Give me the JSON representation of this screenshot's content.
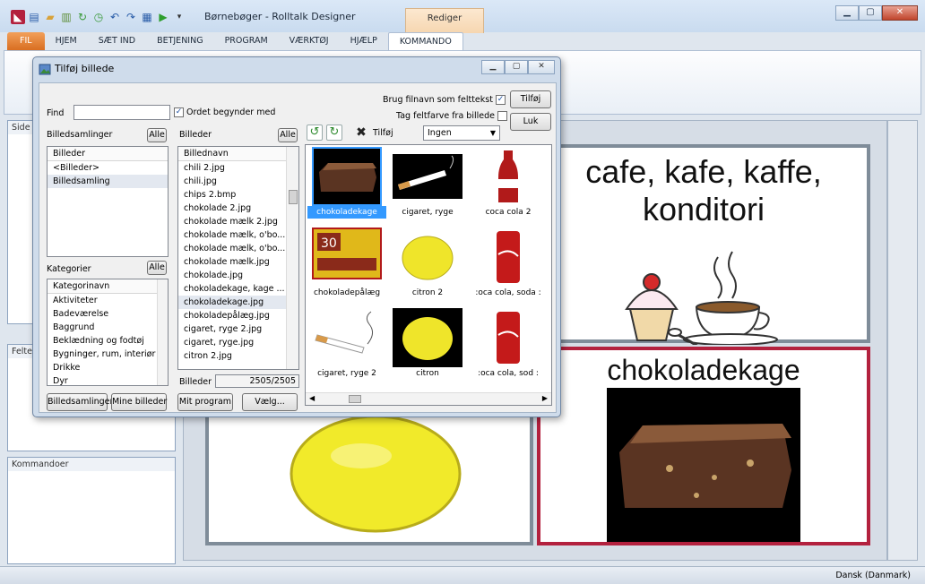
{
  "app": {
    "title": "Børnebøger - Rolltalk Designer",
    "context_tab": "Rediger"
  },
  "ribbon_tabs": [
    {
      "label": "FIL"
    },
    {
      "label": "HJEM"
    },
    {
      "label": "SÆT IND"
    },
    {
      "label": "BETJENING"
    },
    {
      "label": "PROGRAM"
    },
    {
      "label": "VÆRKTØJ"
    },
    {
      "label": "HJÆLP"
    },
    {
      "label": "KOMMANDO"
    }
  ],
  "left_panel": {
    "sider_label": "Side",
    "felter_label": "Felte",
    "kommandoer_label": "Kommandoer"
  },
  "cells": {
    "top_right_text_1": "cafe, kafe, kaffe,",
    "top_right_text_2": "konditori",
    "bottom_right_text": "chokoladekage"
  },
  "status": {
    "language": "Dansk (Danmark)"
  },
  "dialog": {
    "title": "Tilføj billede",
    "find_label": "Find",
    "find_value": "",
    "starts_with_label": "Ordet begynder med",
    "starts_with_checked": true,
    "use_filename_label": "Brug filnavn som felttekst",
    "use_filename_checked": true,
    "take_color_label": "Tag feltfarve fra billede",
    "take_color_checked": false,
    "add_button": "Tilføj",
    "close_button": "Luk",
    "collections_label": "Billedsamlinger",
    "collections_all": "Alle",
    "collections_header": "Billeder",
    "collections": [
      "<Billeder>",
      "Billedsamling"
    ],
    "categories_label": "Kategorier",
    "categories_all": "Alle",
    "categories_header": "Kategorinavn",
    "categories": [
      "Aktiviteter",
      "Badeværelse",
      "Baggrund",
      "Beklædning og fodtøj",
      "Bygninger, rum, interiør",
      "Drikke",
      "Dyr"
    ],
    "images_label": "Billeder",
    "images_all": "Alle",
    "images_header": "Billednavn",
    "images": [
      "chili 2.jpg",
      "chili.jpg",
      "chips 2.bmp",
      "chokolade 2.jpg",
      "chokolade mælk 2.jpg",
      "chokolade mælk, o'bo...",
      "chokolade mælk, o'bo...",
      "chokolade mælk.jpg",
      "chokolade.jpg",
      "chokoladekage, kage ...",
      "chokoladekage.jpg",
      "chokoladepålæg.jpg",
      "cigaret, ryge 2.jpg",
      "cigaret, ryge.jpg",
      "citron 2.jpg"
    ],
    "images_count_label": "Billeder",
    "images_count": "2505/2505",
    "toolbar_add_label": "Tilføj",
    "filter_value": "Ingen",
    "bottom_buttons": [
      "Billedsamlinger",
      "Mine billeder",
      "Mit program",
      "Vælg..."
    ],
    "thumbnails": [
      {
        "label": "chokoladekage",
        "icon": "brownie-icon"
      },
      {
        "label": "cigaret, ryge",
        "icon": "cigarette-icon"
      },
      {
        "label": "coca cola 2",
        "icon": "cola-bottle-icon"
      },
      {
        "label": "chokoladepålæg",
        "icon": "chocolate-spread-icon"
      },
      {
        "label": "citron 2",
        "icon": "lemon-icon"
      },
      {
        "label": ":oca cola, soda :",
        "icon": "cola-can-icon"
      },
      {
        "label": "cigaret, ryge 2",
        "icon": "cigarette-icon"
      },
      {
        "label": "citron",
        "icon": "lemon-icon"
      },
      {
        "label": ":oca cola, sod :",
        "icon": "cola-can-icon"
      }
    ]
  }
}
